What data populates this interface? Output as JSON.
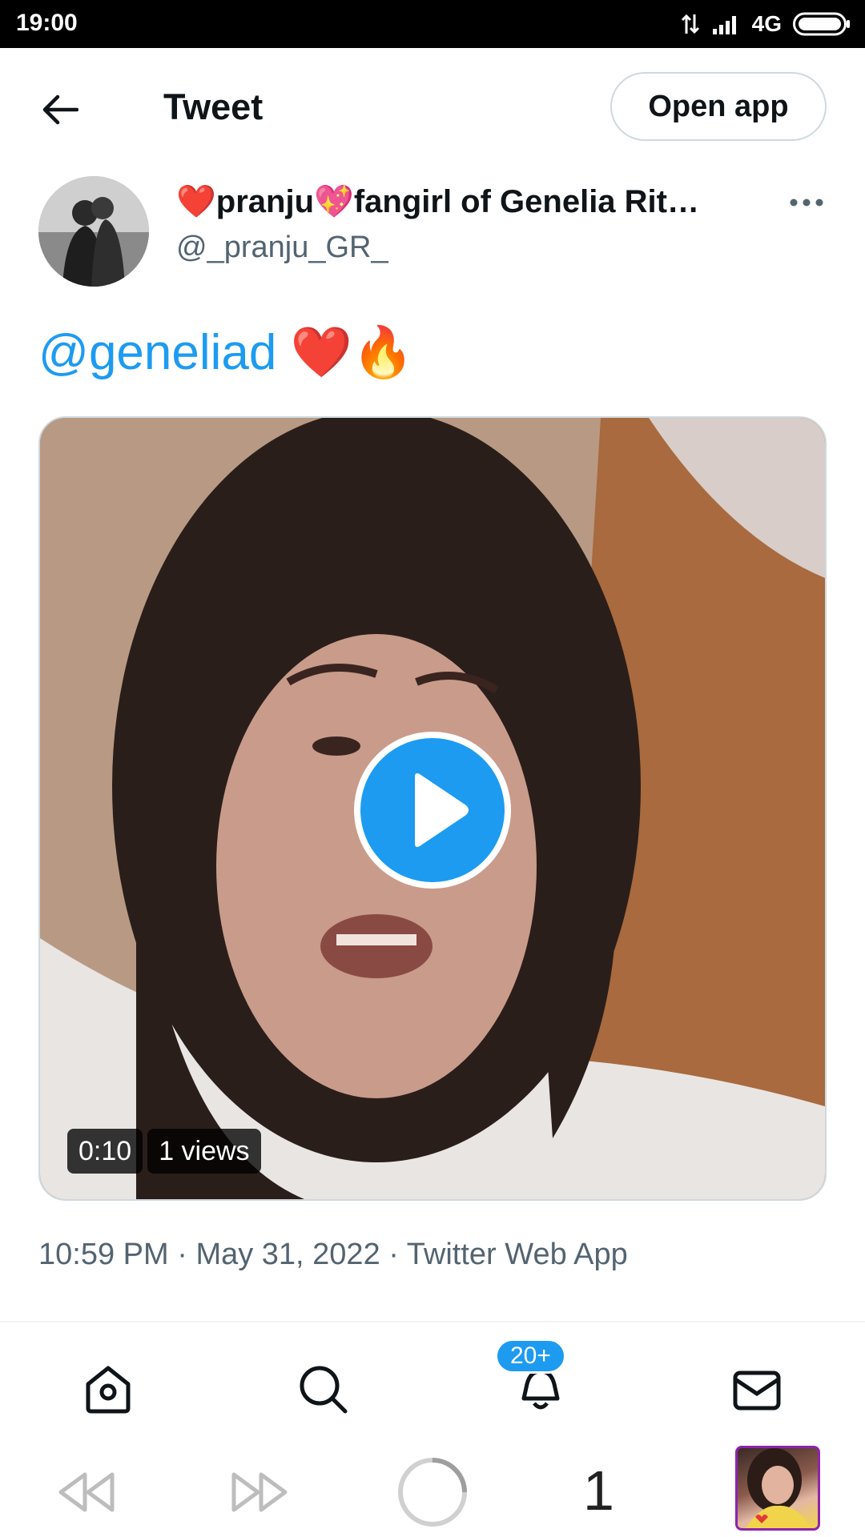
{
  "status_bar": {
    "time": "19:00",
    "network": "4G"
  },
  "header": {
    "title": "Tweet",
    "open_app_label": "Open app"
  },
  "tweet": {
    "author_name": "❤️pranju💖fangirl of Genelia Rit…",
    "author_handle": "@_pranju_GR_",
    "mention": "@geneliad",
    "emojis": "❤️🔥",
    "video": {
      "duration": "0:10",
      "views": "1 views"
    },
    "time": "10:59 PM",
    "separator": "·",
    "date": "May 31, 2022",
    "source": "Twitter Web App"
  },
  "bottom_nav": {
    "notifications_badge": "20+",
    "items": [
      "home-icon",
      "search-icon",
      "bell-icon",
      "mail-icon"
    ]
  },
  "system_bar": {
    "tab_count": "1"
  },
  "colors": {
    "accent": "#1d9bf0",
    "secondary_text": "#536471",
    "border": "#cfd9de"
  }
}
